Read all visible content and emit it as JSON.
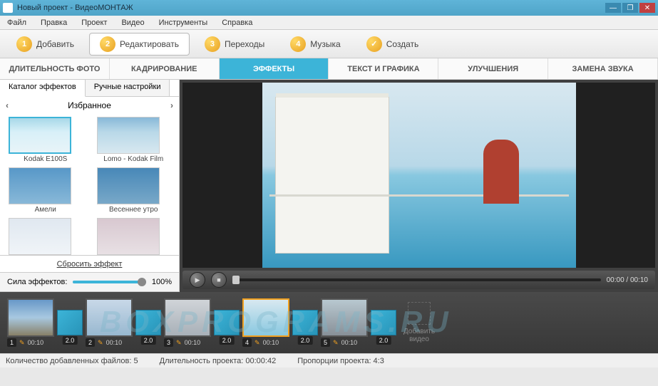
{
  "window": {
    "title": "Новый проект - ВидеоМОНТАЖ"
  },
  "menu": [
    "Файл",
    "Правка",
    "Проект",
    "Видео",
    "Инструменты",
    "Справка"
  ],
  "steps": [
    {
      "num": "1",
      "label": "Добавить"
    },
    {
      "num": "2",
      "label": "Редактировать"
    },
    {
      "num": "3",
      "label": "Переходы"
    },
    {
      "num": "4",
      "label": "Музыка"
    },
    {
      "num": "✓",
      "label": "Создать"
    }
  ],
  "steps_active_index": 1,
  "subtabs": [
    "ДЛИТЕЛЬНОСТЬ ФОТО",
    "КАДРИРОВАНИЕ",
    "ЭФФЕКТЫ",
    "ТЕКСТ И ГРАФИКА",
    "УЛУЧШЕНИЯ",
    "ЗАМЕНА ЗВУКА"
  ],
  "subtabs_active_index": 2,
  "left_panel": {
    "tabs": [
      "Каталог эффектов",
      "Ручные настройки"
    ],
    "active_tab": 0,
    "category": "Избранное",
    "effects": [
      {
        "label": "Kodak E100S",
        "selected": true
      },
      {
        "label": "Lomo - Kodak Film",
        "selected": false
      },
      {
        "label": "Амели",
        "selected": false
      },
      {
        "label": "Весеннее утро",
        "selected": false
      },
      {
        "label": "",
        "selected": false
      },
      {
        "label": "",
        "selected": false
      }
    ],
    "reset": "Сбросить эффект"
  },
  "slider": {
    "label": "Сила эффектов:",
    "value": "100%"
  },
  "playback": {
    "time": "00:00 / 00:10"
  },
  "timeline": {
    "clips": [
      {
        "index": "1",
        "duration": "00:10"
      },
      {
        "index": "2",
        "duration": "00:10"
      },
      {
        "index": "3",
        "duration": "00:10"
      },
      {
        "index": "4",
        "duration": "00:10"
      },
      {
        "index": "5",
        "duration": "00:10"
      }
    ],
    "selected_clip": 3,
    "transition_duration": "2.0",
    "add_label": "Добавить видео"
  },
  "status": {
    "files": "Количество добавленных файлов: 5",
    "duration": "Длительность проекта:    00:00:42",
    "ratio": "Пропорции проекта:    4:3"
  },
  "watermark": "BOXPROGRAMS.RU"
}
